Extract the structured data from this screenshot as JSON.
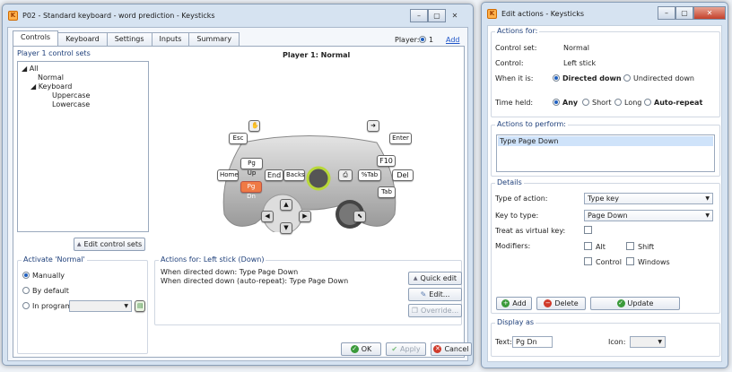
{
  "main_window": {
    "title": "P02 - Standard keyboard - word prediction - Keysticks",
    "tabs": [
      "Controls",
      "Keyboard",
      "Settings",
      "Inputs",
      "Summary"
    ],
    "player_label": "Player:",
    "player_value": "1",
    "add_link": "Add",
    "control_sets": {
      "label": "Player 1 control sets",
      "tree": [
        "All",
        "Normal",
        "Keyboard",
        "Uppercase",
        "Lowercase"
      ],
      "edit_button": "Edit control sets"
    },
    "controller_title": "Player 1: Normal",
    "keys": {
      "esc": "Esc",
      "enter": "Enter",
      "f10": "F10",
      "del": "Del",
      "tab": "Tab",
      "pgup": "Pg Up",
      "pgdn": "Pg Dn",
      "home": "Home",
      "end": "End",
      "backs": "Backs",
      "pctab": "%Tab"
    },
    "activate": {
      "label": "Activate 'Normal'",
      "manually": "Manually",
      "by_default": "By default",
      "in_program": "In program:"
    },
    "actions_for": {
      "label": "Actions for: Left stick (Down)",
      "line1": "When directed down: Type Page Down",
      "line2": "When directed down (auto-repeat): Type Page Down",
      "quick_edit": "Quick edit",
      "edit": "Edit...",
      "override": "Override..."
    },
    "footer": {
      "ok": "OK",
      "apply": "Apply",
      "cancel": "Cancel"
    }
  },
  "edit_window": {
    "title": "Edit actions - Keysticks",
    "actions_for": {
      "label": "Actions for:",
      "control_set_label": "Control set:",
      "control_set_value": "Normal",
      "control_label": "Control:",
      "control_value": "Left stick",
      "when_label": "When it is:",
      "directed_down": "Directed down",
      "undirected_down": "Undirected down",
      "time_label": "Time held:",
      "any": "Any",
      "short": "Short",
      "long": "Long",
      "auto_repeat": "Auto-repeat"
    },
    "to_perform": {
      "label": "Actions to perform:",
      "item": "Type Page Down"
    },
    "details": {
      "label": "Details",
      "type_label": "Type of action:",
      "type_value": "Type key",
      "key_label": "Key to type:",
      "key_value": "Page Down",
      "virtual_label": "Treat as virtual key:",
      "modifiers_label": "Modifiers:",
      "alt": "Alt",
      "shift": "Shift",
      "control": "Control",
      "windows": "Windows",
      "add": "Add",
      "delete": "Delete",
      "update": "Update"
    },
    "display": {
      "label": "Display as",
      "text_label": "Text:",
      "text_value": "Pg Dn",
      "icon_label": "Icon:"
    }
  }
}
